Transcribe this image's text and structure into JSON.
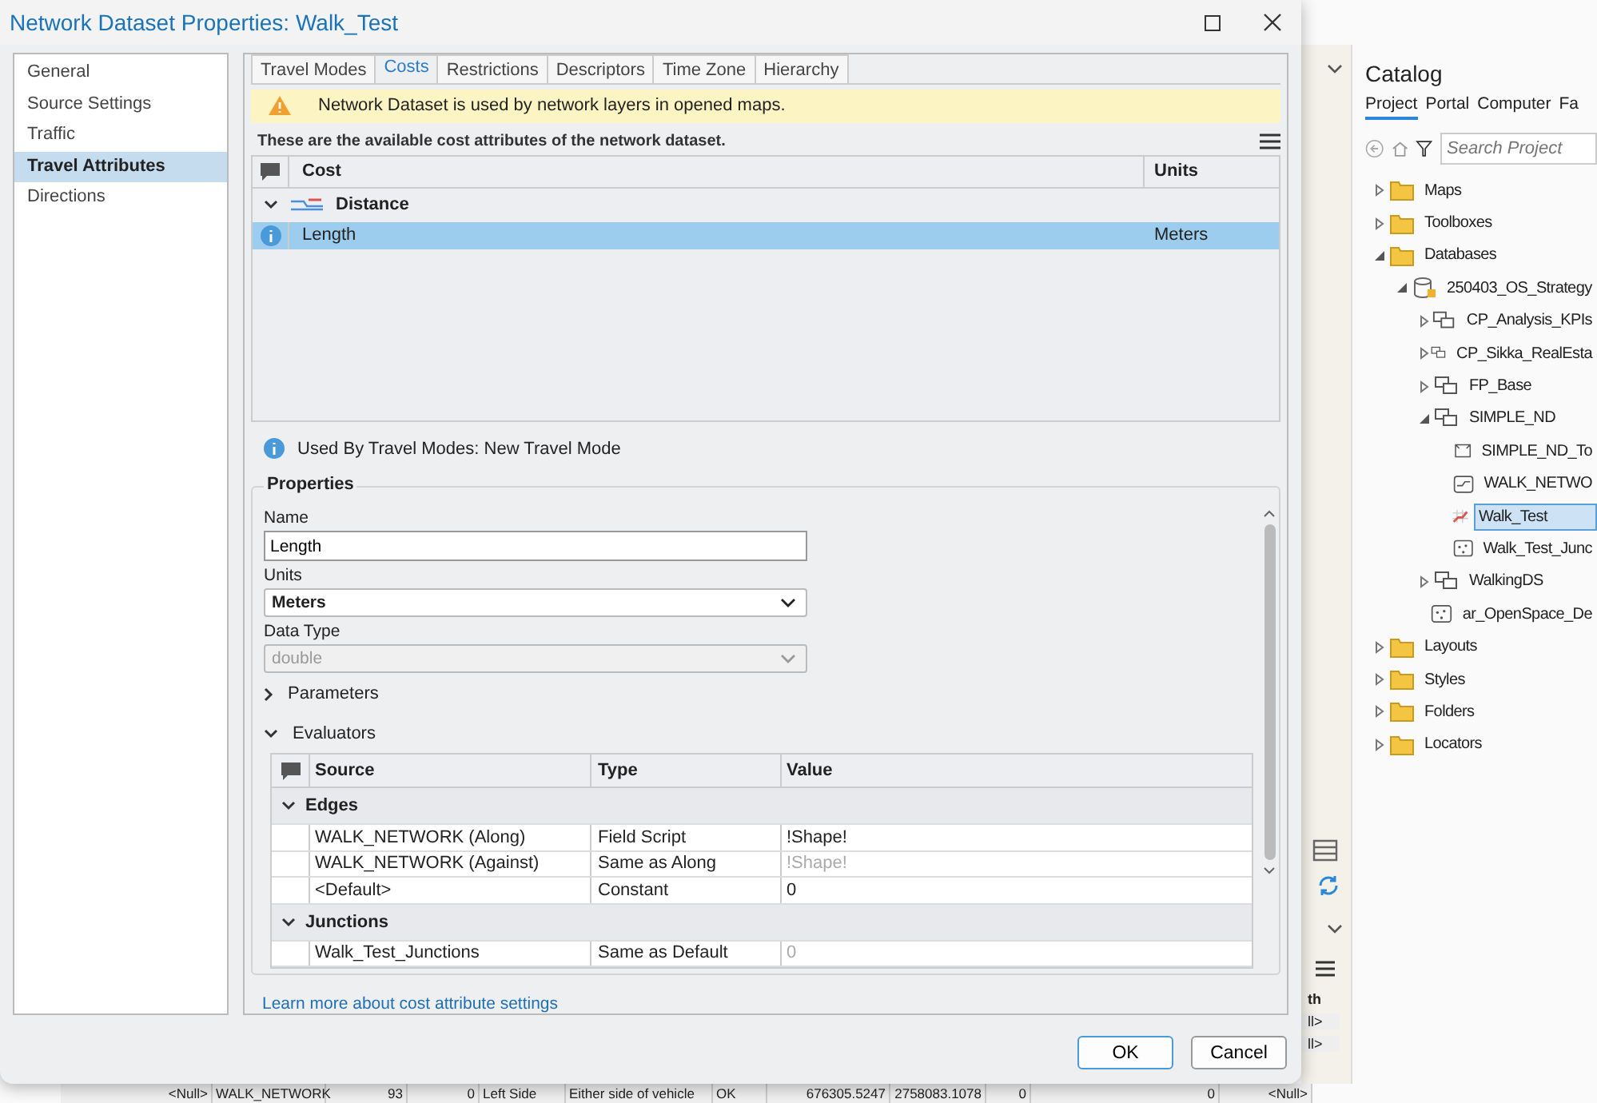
{
  "dialog": {
    "title": "Network Dataset Properties: Walk_Test"
  },
  "sidebar": [
    {
      "label": "General",
      "selected": false
    },
    {
      "label": "Source Settings",
      "selected": false
    },
    {
      "label": "Traffic",
      "selected": false
    },
    {
      "label": "Travel Attributes",
      "selected": true
    },
    {
      "label": "Directions",
      "selected": false
    }
  ],
  "tabs": [
    {
      "label": "Travel Modes",
      "selected": false
    },
    {
      "label": "Costs",
      "selected": true
    },
    {
      "label": "Restrictions",
      "selected": false
    },
    {
      "label": "Descriptors",
      "selected": false
    },
    {
      "label": "Time Zone",
      "selected": false
    },
    {
      "label": "Hierarchy",
      "selected": false
    }
  ],
  "warning": "Network Dataset is used by network layers in opened maps.",
  "intro": "These are the available cost attributes of the network dataset.",
  "cost_table": {
    "columns": [
      "Cost",
      "Units"
    ],
    "groups": [
      {
        "name": "Distance",
        "expanded": true,
        "rows": [
          {
            "cost": "Length",
            "units": "Meters",
            "selected": true
          }
        ]
      }
    ]
  },
  "used_by": "Used By Travel Modes: New Travel Mode",
  "properties": {
    "title": "Properties",
    "name_label": "Name",
    "name_value": "Length",
    "units_label": "Units",
    "units_value": "Meters",
    "data_type_label": "Data Type",
    "data_type_value": "double",
    "data_type_disabled": true
  },
  "sections": [
    {
      "label": "Parameters",
      "expanded": false
    },
    {
      "label": "Evaluators",
      "expanded": true
    }
  ],
  "evaluators": {
    "columns": [
      "Source",
      "Type",
      "Value"
    ],
    "groups": [
      {
        "name": "Edges",
        "expanded": true,
        "rows": [
          {
            "source": "WALK_NETWORK (Along)",
            "type": "Field Script",
            "value": "!Shape!",
            "disabled": false
          },
          {
            "source": "WALK_NETWORK (Against)",
            "type": "Same as Along",
            "value": "!Shape!",
            "disabled": true
          },
          {
            "source": "<Default>",
            "type": "Constant",
            "value": "0",
            "disabled": false
          }
        ]
      },
      {
        "name": "Junctions",
        "expanded": true,
        "rows": [
          {
            "source": "Walk_Test_Junctions",
            "type": "Same as Default",
            "value": "0",
            "disabled": true
          }
        ]
      }
    ]
  },
  "link": "Learn more about cost attribute settings",
  "buttons": [
    {
      "label": "OK",
      "kind": "primary"
    },
    {
      "label": "Cancel",
      "kind": "secondary"
    }
  ],
  "catalog": {
    "title": "Catalog",
    "tabs": [
      {
        "label": "Project",
        "selected": true
      },
      {
        "label": "Portal",
        "selected": false
      },
      {
        "label": "Computer",
        "selected": false
      },
      {
        "label": "Fa",
        "selected": false
      }
    ],
    "search": {
      "placeholder": "Search Project"
    },
    "tree": [
      {
        "label": "Maps",
        "kind": "folder",
        "expanded": false,
        "selected": false
      },
      {
        "label": "Toolboxes",
        "kind": "folder",
        "expanded": false,
        "selected": false
      },
      {
        "label": "Databases",
        "kind": "folder",
        "expanded": true,
        "selected": false,
        "children": [
          {
            "label": "250403_OS_Strategy",
            "kind": "geodatabase",
            "expanded": true,
            "selected": false,
            "children": [
              {
                "label": "CP_Analysis_KPIs",
                "kind": "dataset",
                "expanded": false,
                "selected": false
              },
              {
                "label": "CP_Sikka_RealEsta",
                "kind": "dataset",
                "expanded": false,
                "selected": false
              },
              {
                "label": "FP_Base",
                "kind": "dataset",
                "expanded": false,
                "selected": false
              },
              {
                "label": "SIMPLE_ND",
                "kind": "dataset",
                "expanded": true,
                "selected": false,
                "children": [
                  {
                    "label": "SIMPLE_ND_To",
                    "kind": "topology",
                    "selected": false
                  },
                  {
                    "label": "WALK_NETWO",
                    "kind": "line",
                    "selected": false
                  },
                  {
                    "label": "Walk_Test",
                    "kind": "network",
                    "selected": true
                  },
                  {
                    "label": "Walk_Test_Junc",
                    "kind": "point",
                    "selected": false
                  }
                ]
              },
              {
                "label": "WalkingDS",
                "kind": "dataset",
                "expanded": false,
                "selected": false
              },
              {
                "label": "ar_OpenSpace_De",
                "kind": "point",
                "selected": false
              }
            ]
          }
        ]
      },
      {
        "label": "Layouts",
        "kind": "folder",
        "expanded": false,
        "selected": false
      },
      {
        "label": "Styles",
        "kind": "folder",
        "expanded": false,
        "selected": false
      },
      {
        "label": "Folders",
        "kind": "folder",
        "expanded": false,
        "selected": false
      },
      {
        "label": "Locators",
        "kind": "folder",
        "expanded": false,
        "selected": false
      }
    ]
  },
  "side_table": {
    "header": "th",
    "cells": [
      "ll>",
      "ll>"
    ]
  },
  "attribute_row": [
    "<Null>",
    "WALK_NETWORK",
    "93",
    "0",
    "Left Side",
    "Either side of vehicle",
    "OK",
    "676305.5247",
    "2758083.1078",
    "0",
    "0",
    "<Null>"
  ]
}
